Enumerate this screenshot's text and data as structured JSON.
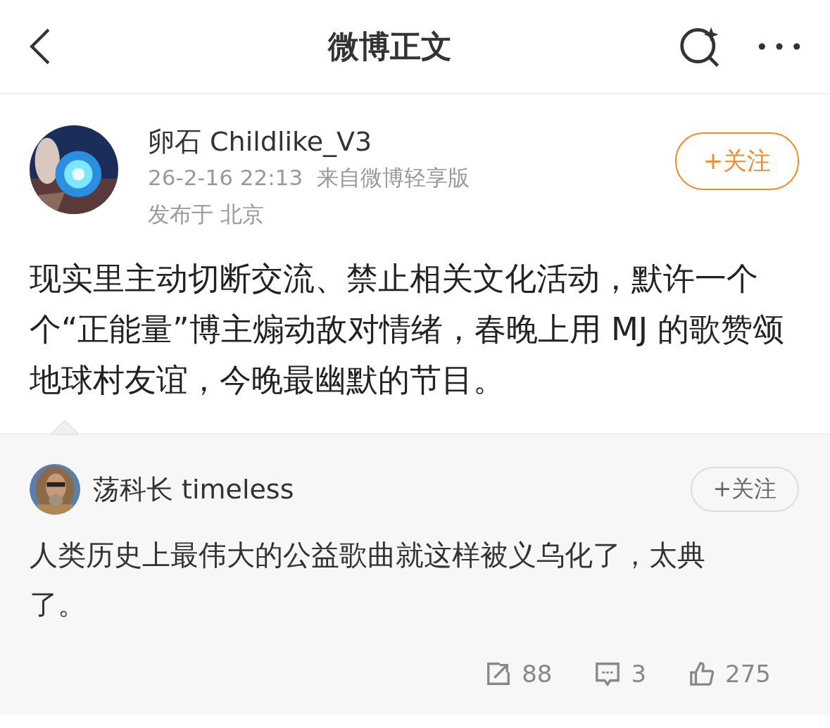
{
  "header": {
    "title": "微博正文"
  },
  "post": {
    "author": "卵石 Childlike_V3",
    "follow": "+关注",
    "time": "26-2-16 22:13",
    "source": "来自微博轻享版",
    "location": "发布于 北京",
    "text": "现实里主动切断交流、禁止相关文化活动，默许一个个“正能量”博主煽动敌对情绪，春晚上用 MJ 的歌赞颂地球村友谊，今晚最幽默的节目。"
  },
  "repost": {
    "author": "荡科长 timeless",
    "follow": "+关注",
    "text": "人类历史上最伟大的公益歌曲就这样被义乌化了，太典了。",
    "actions": [
      {
        "kind": "share",
        "count": "88"
      },
      {
        "kind": "comment",
        "count": "3"
      },
      {
        "kind": "like",
        "count": "275"
      }
    ]
  }
}
